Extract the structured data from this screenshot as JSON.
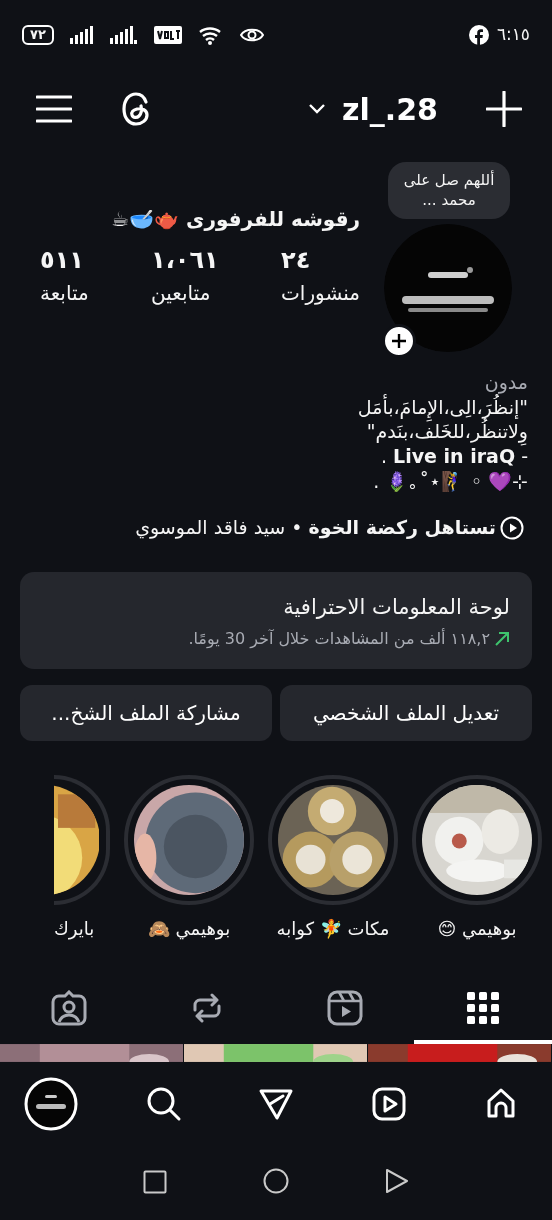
{
  "status_bar": {
    "battery": "٧٢",
    "time": "٦:١٥"
  },
  "header": {
    "username": "zl_.28"
  },
  "profile": {
    "note": "أللهم صل على محمد ...",
    "name": "رقوشه للفرفورى 🫖🥣☕",
    "stats": [
      {
        "value": "٢٤",
        "label": "منشورات"
      },
      {
        "value": "١،٠٦١",
        "label": "متابعين"
      },
      {
        "value": "٥١١",
        "label": "متابعة"
      }
    ],
    "category": "مدون",
    "bio": [
      "\"إنظُرَ،الِى،الإِمامَ،بأمَل",
      "وِلاتنظُر،للخَلف،بنَدم\"",
      "- **Live in iraQ** .",
      "⊹💜 ◦ 🧗‍♀️⋆˚｡🪻 ."
    ],
    "music": {
      "title": "تستاهل ركضة الخوة",
      "separator": "•",
      "artist": "سيد فاقد الموسوي"
    }
  },
  "dashboard": {
    "title": "لوحة المعلومات الاحترافية",
    "subtitle": "١١٨,٢ ألف من المشاهدات خلال آخر 30 يومًا."
  },
  "buttons": [
    "تعديل الملف الشخصي",
    "مشاركة الملف الشخ..."
  ],
  "highlights": [
    {
      "label": "بوهيمي 😊",
      "cut": false
    },
    {
      "label": "مكات 🧚 كوابه",
      "cut": false
    },
    {
      "label": "بوهيمي 🙈",
      "cut": false
    },
    {
      "label": "بايرك",
      "cut": true
    }
  ],
  "tabs": [
    {
      "kind": "grid",
      "selected": true
    },
    {
      "kind": "reels",
      "selected": false
    },
    {
      "kind": "reposts",
      "selected": false
    },
    {
      "kind": "tagged",
      "selected": false
    }
  ],
  "bottom_nav": [
    {
      "kind": "home"
    },
    {
      "kind": "reels"
    },
    {
      "kind": "send"
    },
    {
      "kind": "search"
    },
    {
      "kind": "profile"
    }
  ]
}
